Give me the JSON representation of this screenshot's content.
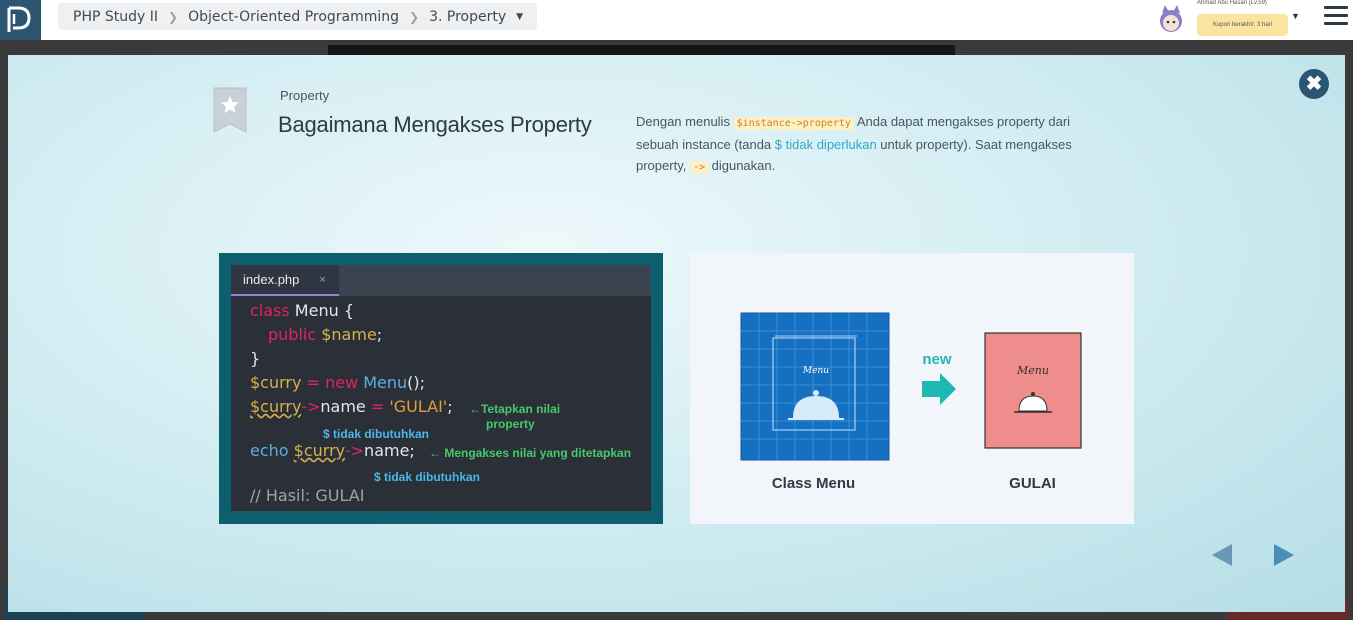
{
  "breadcrumb": {
    "course": "PHP Study II",
    "chapter": "Object-Oriented Programming",
    "lesson": "3. Property"
  },
  "user": {
    "name": "Ahmad Abu Hasan (Lv.59)",
    "coupon": "Kupon berakhir: 3 hari"
  },
  "slide": {
    "label": "Property",
    "title": "Bagaimana Mengakses Property",
    "desc_part1": "Dengan menulis ",
    "desc_code1": "$instance->property",
    "desc_part2": " Anda dapat mengakses property dari sebuah instance (tanda ",
    "desc_blue": "$ tidak diperlukan",
    "desc_part3": " untuk property). Saat mengakses property, ",
    "desc_code2": "->",
    "desc_part4": " digunakan."
  },
  "editor": {
    "filename": "index.php",
    "close": "×",
    "annotation_set": "←Tetapkan nilai",
    "annotation_set2": "property",
    "annotation_get": "← Mengakses nilai yang ditetapkan",
    "annotation_no_dollar": "$ tidak dibutuhkan",
    "comment": "// Hasil: GULAI"
  },
  "illustration": {
    "class_label": "Class Menu",
    "instance_label": "GULAI",
    "arrow_label": "new",
    "menu_text": "Menu"
  },
  "colors": {
    "brand": "#2b5571",
    "accent": "#1fb9b3"
  }
}
